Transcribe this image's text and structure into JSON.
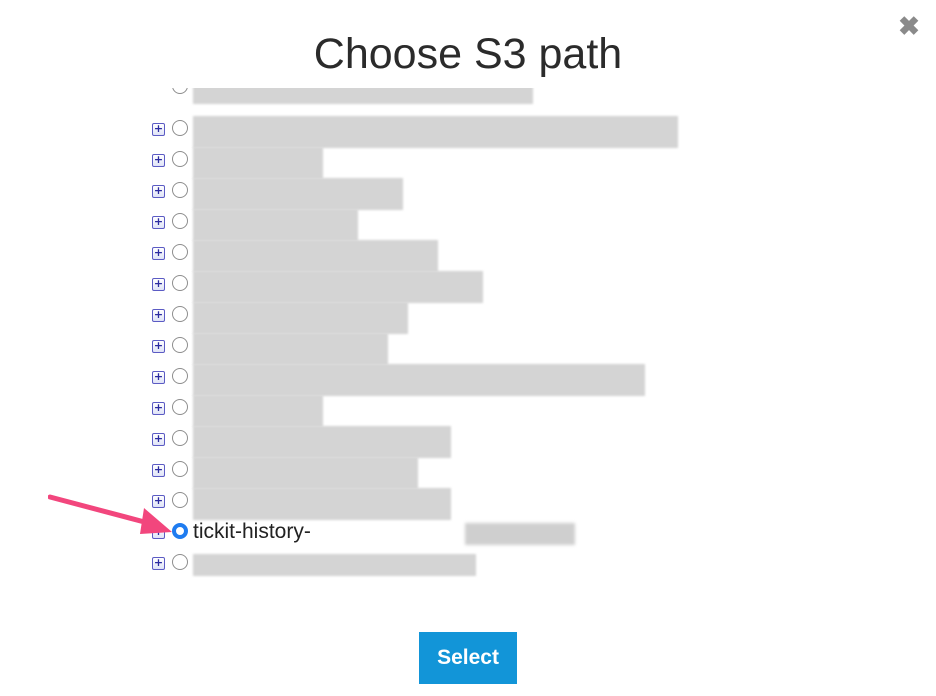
{
  "dialog": {
    "title": "Choose S3 path",
    "close_icon": "close-icon",
    "select_label": "Select"
  },
  "tree": {
    "expander_icon": "plus-square-icon",
    "selected_item_label": "tickit-history-",
    "accent_color": "#1f7cf0",
    "arrow_color": "#f2467d"
  }
}
